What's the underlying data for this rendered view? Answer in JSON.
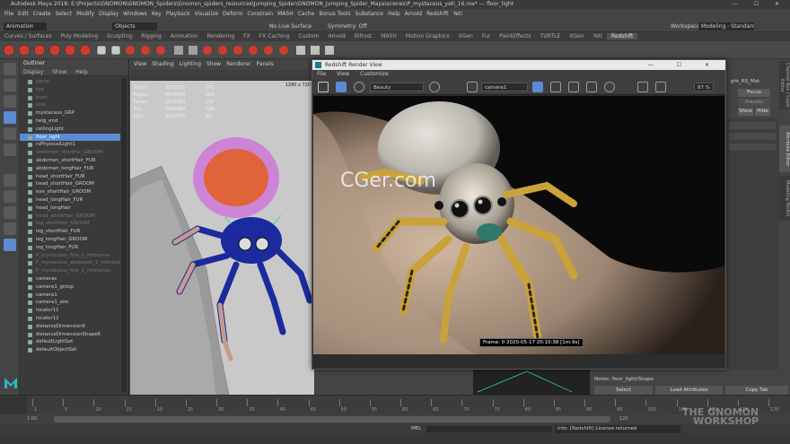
{
  "window": {
    "title": "Autodesk Maya 2018: E:\\Projects\\GNOMON\\GNOMON_Spiders\\Gnomon_spiders_resources\\Jumping_Spider\\GNOMON_Jumping_Spider_Maya\\scenes\\P_mystaceus_yeti_16.ma* --- floor_light"
  },
  "menubar": [
    "File",
    "Edit",
    "Create",
    "Select",
    "Modify",
    "Display",
    "Windows",
    "Key",
    "Playback",
    "Visualize",
    "Deform",
    "Constrain",
    "MASH",
    "Cache",
    "Bonus Tools",
    "Substance",
    "Help",
    "Arnold",
    "Redshift",
    "Yeti"
  ],
  "statusline": {
    "mode": "Animation",
    "objects_label": "Objects",
    "live_surface": "No Live Surface",
    "symmetry": "Symmetry: Off",
    "workspace_label": "Workspace :",
    "workspace_value": "Modeling - Standard*"
  },
  "shelf_tabs": [
    "Curves / Surfaces",
    "Poly Modeling",
    "Sculpting",
    "Rigging",
    "Animation",
    "Rendering",
    "FX",
    "FX Caching",
    "Custom",
    "Arnold",
    "Bifrost",
    "MASH",
    "Motion Graphics",
    "XGen",
    "Fur",
    "PaintEffects",
    "TURTLE",
    "XGen",
    "Yeti",
    "Redshift"
  ],
  "shelf_active": "Redshift",
  "outliner": {
    "title": "Outliner",
    "menu": [
      "Display",
      "Show",
      "Help"
    ],
    "items": [
      {
        "label": "persp",
        "state": "dim"
      },
      {
        "label": "top",
        "state": "dim"
      },
      {
        "label": "front",
        "state": "dim"
      },
      {
        "label": "side",
        "state": "dim"
      },
      {
        "label": "mystaceus_GRP",
        "state": "normal"
      },
      {
        "label": "twig_end",
        "state": "normal"
      },
      {
        "label": "ceilingLight",
        "state": "normal"
      },
      {
        "label": "floor_light",
        "state": "sel"
      },
      {
        "label": "rsPhysicalLight1",
        "state": "normal"
      },
      {
        "label": "abdomen_shortFur_GROOM",
        "state": "dim"
      },
      {
        "label": "abdomen_shortHair_FUR",
        "state": "normal"
      },
      {
        "label": "abdomen_longHair_FUR",
        "state": "normal"
      },
      {
        "label": "head_shortHair_FUR",
        "state": "normal"
      },
      {
        "label": "head_shortHair_GROOM",
        "state": "normal"
      },
      {
        "label": "eye_shortHair_GROOM",
        "state": "normal"
      },
      {
        "label": "head_longHair_FUR",
        "state": "normal"
      },
      {
        "label": "head_longHair",
        "state": "normal"
      },
      {
        "label": "head_whiteHair_GROOM",
        "state": "dim"
      },
      {
        "label": "leg_shortHair_GROOM",
        "state": "dim"
      },
      {
        "label": "leg_shortHair_FUR",
        "state": "normal"
      },
      {
        "label": "leg_longHair_GROOM",
        "state": "normal"
      },
      {
        "label": "leg_longHair_FUR",
        "state": "normal"
      },
      {
        "label": "P_mystaceus_fine_1_reference",
        "state": "dim"
      },
      {
        "label": "P_mystaceus_abdomen_1_reference",
        "state": "dim"
      },
      {
        "label": "P_mystaceus_fine_1_reference",
        "state": "dim"
      },
      {
        "label": "cameras",
        "state": "normal"
      },
      {
        "label": "camera1_group",
        "state": "normal"
      },
      {
        "label": "camera1",
        "state": "normal"
      },
      {
        "label": "camera1_aim",
        "state": "normal"
      },
      {
        "label": "locator11",
        "state": "normal"
      },
      {
        "label": "locator12",
        "state": "normal"
      },
      {
        "label": "distanceDimension6",
        "state": "normal"
      },
      {
        "label": "distanceDimensionShape6",
        "state": "normal"
      },
      {
        "label": "defaultLightSet",
        "state": "normal"
      },
      {
        "label": "defaultObjectSet",
        "state": "normal"
      }
    ]
  },
  "viewport": {
    "menu": [
      "View",
      "Shading",
      "Lighting",
      "Show",
      "Renderer",
      "Panels"
    ],
    "resolution": "1280 x 720",
    "hud": [
      {
        "k": "Verts:",
        "a": "3581015",
        "b": "103"
      },
      {
        "k": "Edges:",
        "a": "5824930",
        "b": "164"
      },
      {
        "k": "Faces:",
        "a": "2871083",
        "b": "152"
      },
      {
        "k": "Tris:",
        "a": "5992890",
        "b": "128"
      },
      {
        "k": "UVs:",
        "a": "4011655",
        "b": "89"
      }
    ]
  },
  "render_view": {
    "title": "Redshift Render View",
    "menu": [
      "File",
      "View",
      "Customize"
    ],
    "aov": "Beauty",
    "camera": "camera1",
    "zoom": "87 %",
    "frame_label": "Frame: 0  2020-05-17  20:10:38  [1m:9s]",
    "watermark": "CGer.com"
  },
  "right_panel": {
    "tabs": [
      "Channel Box / Layer Editor",
      "Attribute Editor",
      "Modeling Toolkit"
    ],
    "node": "ght_RS_Mat",
    "focus": "Focus",
    "presets": "Presets",
    "show": "Show",
    "hide": "Hide",
    "notes": "Notes: floor_light/Shape"
  },
  "bottom_buttons": [
    "Select",
    "Load Attributes",
    "Copy Tab"
  ],
  "timeline": {
    "ticks": [
      "1",
      "5",
      "10",
      "15",
      "20",
      "25",
      "30",
      "35",
      "40",
      "45",
      "50",
      "55",
      "60",
      "65",
      "70",
      "75",
      "80",
      "85",
      "90",
      "95",
      "100",
      "105",
      "110",
      "115",
      "120"
    ]
  },
  "range": {
    "start": "1.00",
    "end": "120"
  },
  "command": {
    "label": "MEL",
    "result": "Info: [Redshift] License returned"
  },
  "brand": {
    "line1": "THE GNOMON",
    "line2": "WORKSHOP"
  },
  "colors": {
    "accent": "#5d8bd1",
    "fur_magenta": "#d24be0",
    "mesh_blue": "#1b2a9c"
  }
}
